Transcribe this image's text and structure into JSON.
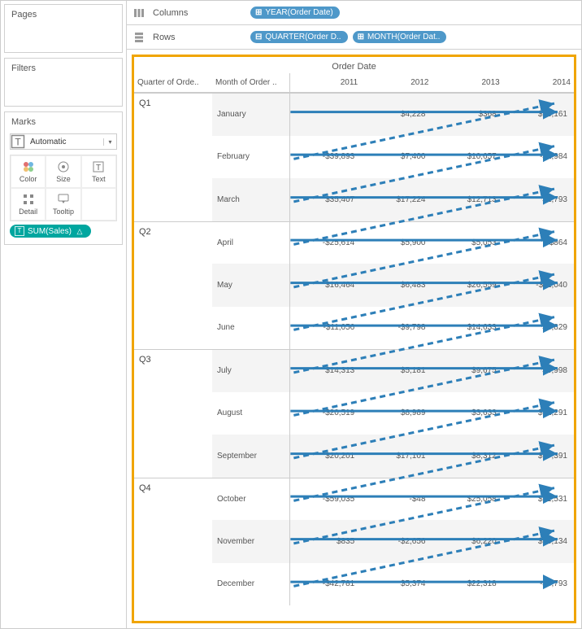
{
  "sidebar": {
    "pages_title": "Pages",
    "filters_title": "Filters",
    "marks_title": "Marks",
    "marks_type": "Automatic",
    "marks_cells": {
      "color": "Color",
      "size": "Size",
      "text": "Text",
      "detail": "Detail",
      "tooltip": "Tooltip"
    },
    "measure_pill": "SUM(Sales)"
  },
  "shelves": {
    "columns_label": "Columns",
    "rows_label": "Rows",
    "columns_pills": [
      {
        "expand": "⊞",
        "label": "YEAR(Order Date)"
      }
    ],
    "rows_pills": [
      {
        "expand": "⊟",
        "label": "QUARTER(Order D.."
      },
      {
        "expand": "⊞",
        "label": "MONTH(Order Dat.."
      }
    ]
  },
  "viz": {
    "title": "Order Date",
    "headers": {
      "quarter": "Quarter of Orde..",
      "month": "Month of Order .."
    },
    "years": [
      "2011",
      "2012",
      "2013",
      "2014"
    ],
    "rows": [
      {
        "quarter": "Q1",
        "month": "January",
        "values": [
          "",
          "$4,228",
          "$368",
          "$26,161"
        ]
      },
      {
        "quarter": "",
        "month": "February",
        "values": [
          "-$39,893",
          "$7,400",
          "$10,657",
          "-$2,984"
        ]
      },
      {
        "quarter": "",
        "month": "March",
        "values": [
          "$35,407",
          "$17,224",
          "$12,713",
          "$2,793"
        ]
      },
      {
        "quarter": "Q2",
        "month": "April",
        "values": [
          "-$25,614",
          "$5,900",
          "$5,053",
          "$864"
        ]
      },
      {
        "quarter": "",
        "month": "May",
        "values": [
          "$16,464",
          "$6,483",
          "$26,559",
          "-$11,040"
        ]
      },
      {
        "quarter": "",
        "month": "June",
        "values": [
          "-$11,056",
          "-$9,798",
          "$14,633",
          "$8,829"
        ]
      },
      {
        "quarter": "Q3",
        "month": "July",
        "values": [
          "$14,313",
          "$5,181",
          "$9,675",
          "$9,998"
        ]
      },
      {
        "quarter": "",
        "month": "August",
        "values": [
          "-$20,519",
          "$8,989",
          "$3,633",
          "$12,291"
        ]
      },
      {
        "quarter": "",
        "month": "September",
        "values": [
          "$20,201",
          "$17,101",
          "$8,312",
          "$17,391"
        ]
      },
      {
        "quarter": "Q4",
        "month": "October",
        "values": [
          "-$59,035",
          "-$48",
          "$25,058",
          "$21,531"
        ]
      },
      {
        "quarter": "",
        "month": "November",
        "values": [
          "$835",
          "-$2,656",
          "$6,220",
          "$30,134"
        ]
      },
      {
        "quarter": "",
        "month": "December",
        "values": [
          "-$42,781",
          "$5,374",
          "$22,318",
          "-$8,793"
        ]
      }
    ]
  },
  "chart_data": {
    "type": "table",
    "title": "Order Date",
    "row_dimensions": [
      "Quarter of Order Date",
      "Month of Order Date"
    ],
    "column_dimension": "YEAR(Order Date)",
    "measure": "SUM(Sales)",
    "columns": [
      "2011",
      "2012",
      "2013",
      "2014"
    ],
    "rows": [
      {
        "quarter": "Q1",
        "month": "January",
        "values": [
          null,
          4228,
          368,
          26161
        ]
      },
      {
        "quarter": "Q1",
        "month": "February",
        "values": [
          -39893,
          7400,
          10657,
          -2984
        ]
      },
      {
        "quarter": "Q1",
        "month": "March",
        "values": [
          35407,
          17224,
          12713,
          2793
        ]
      },
      {
        "quarter": "Q2",
        "month": "April",
        "values": [
          -25614,
          5900,
          5053,
          864
        ]
      },
      {
        "quarter": "Q2",
        "month": "May",
        "values": [
          16464,
          6483,
          26559,
          -11040
        ]
      },
      {
        "quarter": "Q2",
        "month": "June",
        "values": [
          -11056,
          -9798,
          14633,
          8829
        ]
      },
      {
        "quarter": "Q3",
        "month": "July",
        "values": [
          14313,
          5181,
          9675,
          9998
        ]
      },
      {
        "quarter": "Q3",
        "month": "August",
        "values": [
          -20519,
          8989,
          3633,
          12291
        ]
      },
      {
        "quarter": "Q3",
        "month": "September",
        "values": [
          20201,
          17101,
          8312,
          17391
        ]
      },
      {
        "quarter": "Q4",
        "month": "October",
        "values": [
          -59035,
          -48,
          25058,
          21531
        ]
      },
      {
        "quarter": "Q4",
        "month": "November",
        "values": [
          835,
          -2656,
          6220,
          30134
        ]
      },
      {
        "quarter": "Q4",
        "month": "December",
        "values": [
          -42781,
          5374,
          22318,
          -8793
        ]
      }
    ],
    "annotation": "Blue arrows indicate table-calculation direction: solid = table-across, dashed = diagonal then-down"
  },
  "colors": {
    "highlight_border": "#f0a500",
    "arrow": "#2d7fb8",
    "pill_dimension": "#4e98c9",
    "pill_measure": "#00a69f"
  }
}
